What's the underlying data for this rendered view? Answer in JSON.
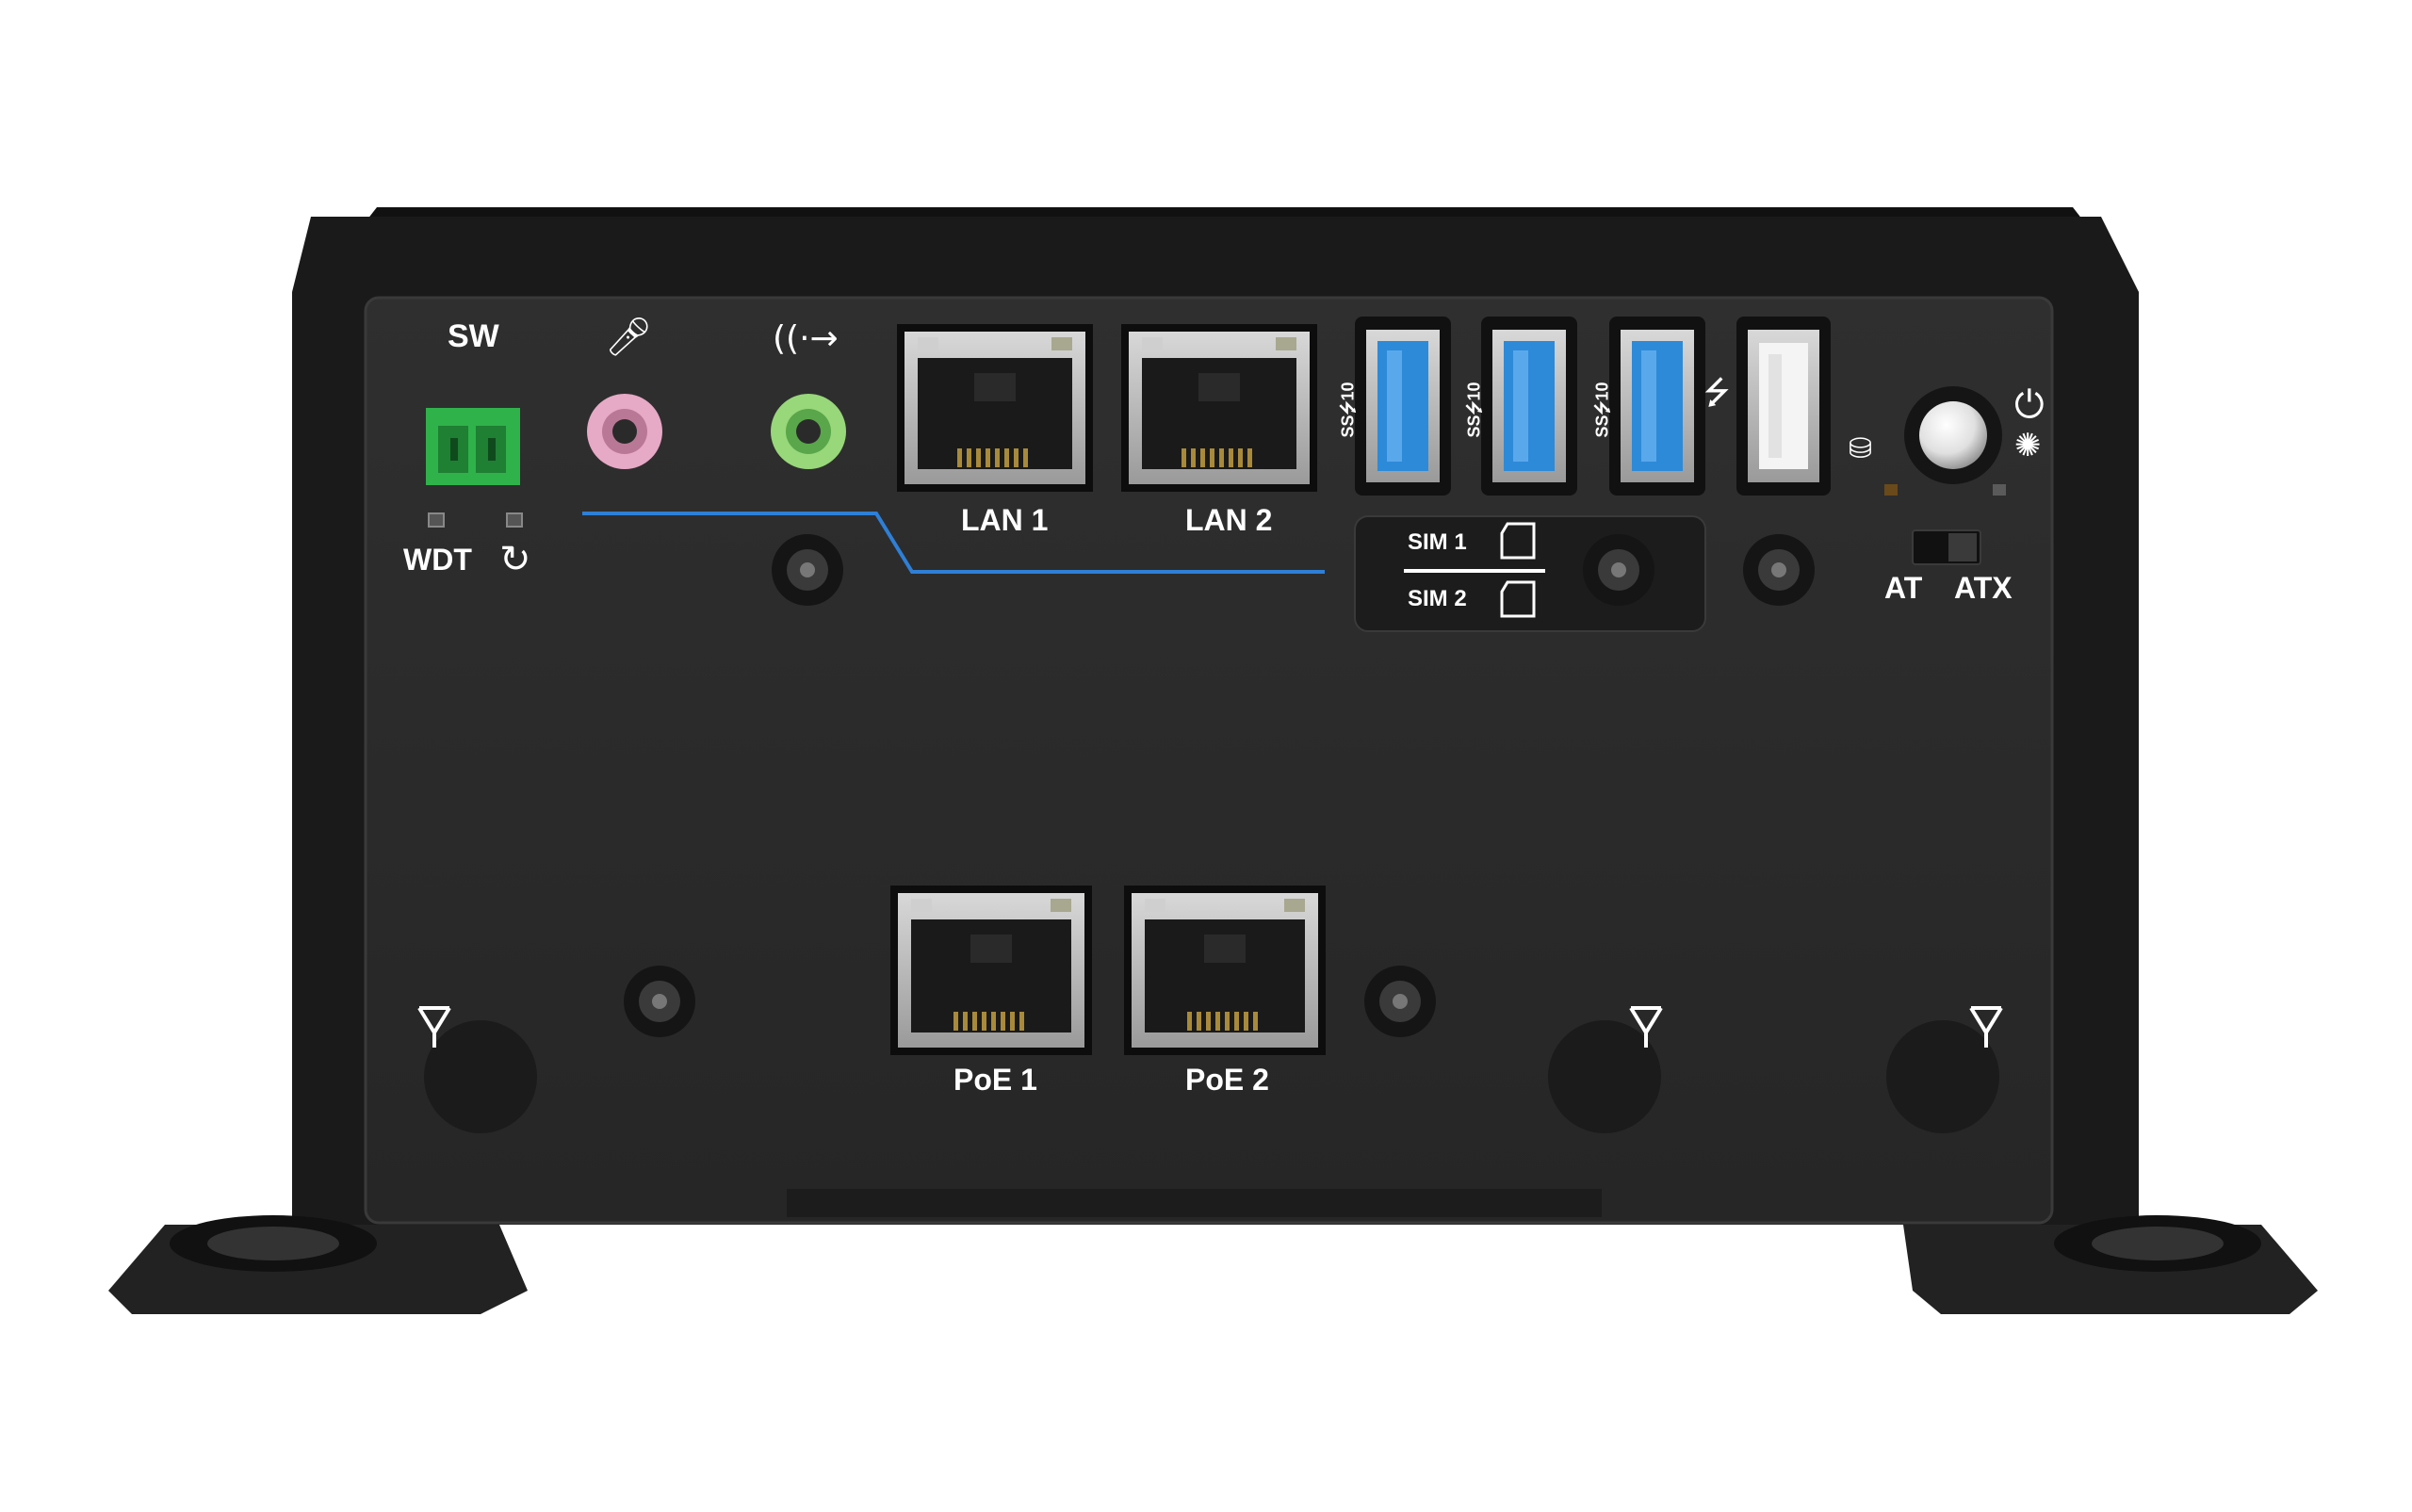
{
  "device": {
    "colors": {
      "chassis": "#1b1b1b",
      "panel": "#2a2a2a",
      "terminal_green": "#2fb24a",
      "mic_pink": "#e6a9c6",
      "line_out_green": "#98d77a",
      "usb3_blue": "#2d8ad8",
      "accent_line": "#2e7fd6"
    },
    "labels": {
      "sw": "SW",
      "wdt": "WDT",
      "lan1": "LAN 1",
      "lan2": "LAN 2",
      "poe1": "PoE 1",
      "poe2": "PoE 2",
      "sim1": "SIM 1",
      "sim2": "SIM 2",
      "at": "AT",
      "atx": "ATX",
      "usb3_mark": "SS⭍10",
      "reset_icon": "reset-icon",
      "mic_icon": "microphone-icon",
      "line_out_icon": "line-out-icon",
      "usb_icon": "usb-icon",
      "hdd_icon": "hdd-led-icon",
      "power_icon": "power-icon",
      "power_led_icon": "power-led-icon",
      "antenna_icon": "antenna-icon"
    }
  }
}
